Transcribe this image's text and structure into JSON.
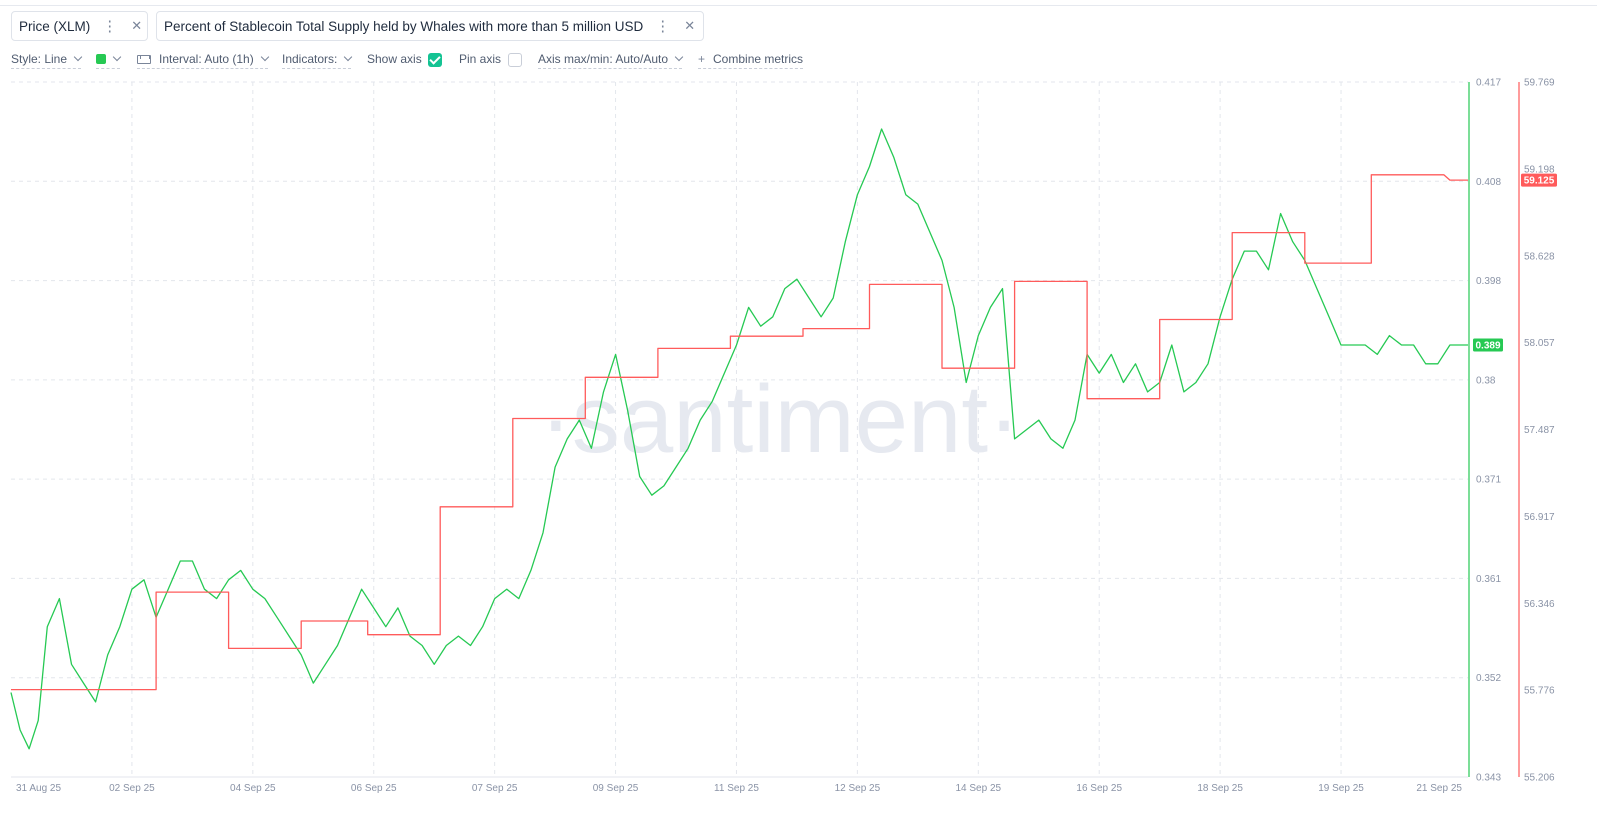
{
  "tabs": [
    {
      "label": "Price (XLM)",
      "color": "#26c953"
    },
    {
      "label": "Percent of Stablecoin Total Supply held by Whales with more than 5 million USD",
      "color": "#ff5b5b"
    }
  ],
  "toolbar": {
    "style": "Style: Line",
    "interval": "Interval: Auto (1h)",
    "indicators": "Indicators:",
    "show_axis": "Show axis",
    "show_axis_checked": true,
    "pin_axis": "Pin axis",
    "pin_axis_checked": false,
    "axis_minmax": "Axis max/min: Auto/Auto",
    "combine": "Combine metrics",
    "plus": "+"
  },
  "watermark": "·santiment·",
  "chart_data": {
    "type": "line",
    "x_dates": [
      "31 Aug 25",
      "02 Sep 25",
      "04 Sep 25",
      "06 Sep 25",
      "07 Sep 25",
      "09 Sep 25",
      "11 Sep 25",
      "12 Sep 25",
      "14 Sep 25",
      "16 Sep 25",
      "18 Sep 25",
      "19 Sep 25",
      "21 Sep 25"
    ],
    "x_tick_positions_day": [
      0,
      2,
      4,
      6,
      8,
      10,
      12,
      14,
      16,
      18,
      20,
      22,
      24
    ],
    "left_axis": {
      "ticks": [
        "0.417",
        "0.408",
        "0.398",
        "0.38",
        "0.371",
        "0.361",
        "0.352",
        "0.343"
      ],
      "ylim": [
        0.343,
        0.417
      ],
      "current": "0.389",
      "color": "#26c953"
    },
    "right_axis": {
      "ticks": [
        "59.769",
        "59.198",
        "58.628",
        "58.057",
        "57.487",
        "56.917",
        "56.346",
        "55.776",
        "55.206"
      ],
      "ylim": [
        55.206,
        59.769
      ],
      "current": "59.125",
      "color": "#ff5b5b"
    },
    "series": [
      {
        "name": "Price (XLM)",
        "axis": "left",
        "color": "#26c953",
        "points": [
          [
            0,
            0.352
          ],
          [
            0.15,
            0.348
          ],
          [
            0.3,
            0.346
          ],
          [
            0.45,
            0.349
          ],
          [
            0.6,
            0.359
          ],
          [
            0.8,
            0.362
          ],
          [
            1,
            0.355
          ],
          [
            1.2,
            0.353
          ],
          [
            1.4,
            0.351
          ],
          [
            1.6,
            0.356
          ],
          [
            1.8,
            0.359
          ],
          [
            2,
            0.363
          ],
          [
            2.2,
            0.364
          ],
          [
            2.4,
            0.36
          ],
          [
            2.6,
            0.363
          ],
          [
            2.8,
            0.366
          ],
          [
            3,
            0.366
          ],
          [
            3.2,
            0.363
          ],
          [
            3.4,
            0.362
          ],
          [
            3.6,
            0.364
          ],
          [
            3.8,
            0.365
          ],
          [
            4,
            0.363
          ],
          [
            4.2,
            0.362
          ],
          [
            4.4,
            0.36
          ],
          [
            4.6,
            0.358
          ],
          [
            4.8,
            0.356
          ],
          [
            5,
            0.353
          ],
          [
            5.2,
            0.355
          ],
          [
            5.4,
            0.357
          ],
          [
            5.6,
            0.36
          ],
          [
            5.8,
            0.363
          ],
          [
            6,
            0.361
          ],
          [
            6.2,
            0.359
          ],
          [
            6.4,
            0.361
          ],
          [
            6.6,
            0.358
          ],
          [
            6.8,
            0.357
          ],
          [
            7,
            0.355
          ],
          [
            7.2,
            0.357
          ],
          [
            7.4,
            0.358
          ],
          [
            7.6,
            0.357
          ],
          [
            7.8,
            0.359
          ],
          [
            8,
            0.362
          ],
          [
            8.2,
            0.363
          ],
          [
            8.4,
            0.362
          ],
          [
            8.6,
            0.365
          ],
          [
            8.8,
            0.369
          ],
          [
            9,
            0.376
          ],
          [
            9.2,
            0.379
          ],
          [
            9.4,
            0.381
          ],
          [
            9.6,
            0.378
          ],
          [
            9.8,
            0.384
          ],
          [
            10,
            0.388
          ],
          [
            10.2,
            0.382
          ],
          [
            10.4,
            0.375
          ],
          [
            10.6,
            0.373
          ],
          [
            10.8,
            0.374
          ],
          [
            11,
            0.376
          ],
          [
            11.2,
            0.378
          ],
          [
            11.4,
            0.381
          ],
          [
            11.6,
            0.383
          ],
          [
            11.8,
            0.386
          ],
          [
            12,
            0.389
          ],
          [
            12.2,
            0.393
          ],
          [
            12.4,
            0.391
          ],
          [
            12.6,
            0.392
          ],
          [
            12.8,
            0.395
          ],
          [
            13,
            0.396
          ],
          [
            13.2,
            0.394
          ],
          [
            13.4,
            0.392
          ],
          [
            13.6,
            0.394
          ],
          [
            13.8,
            0.4
          ],
          [
            14,
            0.405
          ],
          [
            14.2,
            0.408
          ],
          [
            14.4,
            0.412
          ],
          [
            14.6,
            0.409
          ],
          [
            14.8,
            0.405
          ],
          [
            15,
            0.404
          ],
          [
            15.2,
            0.401
          ],
          [
            15.4,
            0.398
          ],
          [
            15.6,
            0.393
          ],
          [
            15.8,
            0.385
          ],
          [
            16,
            0.39
          ],
          [
            16.2,
            0.393
          ],
          [
            16.4,
            0.395
          ],
          [
            16.6,
            0.379
          ],
          [
            16.8,
            0.38
          ],
          [
            17,
            0.381
          ],
          [
            17.2,
            0.379
          ],
          [
            17.4,
            0.378
          ],
          [
            17.6,
            0.381
          ],
          [
            17.8,
            0.388
          ],
          [
            18,
            0.386
          ],
          [
            18.2,
            0.388
          ],
          [
            18.4,
            0.385
          ],
          [
            18.6,
            0.387
          ],
          [
            18.8,
            0.384
          ],
          [
            19,
            0.385
          ],
          [
            19.2,
            0.389
          ],
          [
            19.4,
            0.384
          ],
          [
            19.6,
            0.385
          ],
          [
            19.8,
            0.387
          ],
          [
            20,
            0.392
          ],
          [
            20.2,
            0.396
          ],
          [
            20.4,
            0.399
          ],
          [
            20.6,
            0.399
          ],
          [
            20.8,
            0.397
          ],
          [
            21,
            0.403
          ],
          [
            21.2,
            0.4
          ],
          [
            21.4,
            0.398
          ],
          [
            21.6,
            0.395
          ],
          [
            21.8,
            0.392
          ],
          [
            22,
            0.389
          ],
          [
            22.2,
            0.389
          ],
          [
            22.4,
            0.389
          ],
          [
            22.6,
            0.388
          ],
          [
            22.8,
            0.39
          ],
          [
            23,
            0.389
          ],
          [
            23.2,
            0.389
          ],
          [
            23.4,
            0.387
          ],
          [
            23.6,
            0.387
          ],
          [
            23.8,
            0.389
          ],
          [
            24,
            0.389
          ],
          [
            24.1,
            0.389
          ]
        ]
      },
      {
        "name": "Percent of Stablecoin Total Supply held by Whales with more than 5 million USD",
        "axis": "right",
        "color": "#ff5b5b",
        "points": [
          [
            0,
            55.78
          ],
          [
            1.2,
            55.78
          ],
          [
            2.4,
            55.78
          ],
          [
            2.4,
            56.42
          ],
          [
            3.6,
            56.42
          ],
          [
            3.6,
            56.05
          ],
          [
            4.8,
            56.05
          ],
          [
            4.8,
            56.23
          ],
          [
            5.9,
            56.23
          ],
          [
            5.9,
            56.14
          ],
          [
            7.1,
            56.14
          ],
          [
            7.1,
            56.98
          ],
          [
            8.3,
            56.98
          ],
          [
            8.3,
            57.56
          ],
          [
            9.5,
            57.56
          ],
          [
            9.5,
            57.83
          ],
          [
            10.7,
            57.83
          ],
          [
            10.7,
            58.02
          ],
          [
            11.9,
            58.02
          ],
          [
            11.9,
            58.1
          ],
          [
            13.1,
            58.1
          ],
          [
            13.1,
            58.15
          ],
          [
            14.2,
            58.15
          ],
          [
            14.2,
            58.44
          ],
          [
            15.4,
            58.44
          ],
          [
            15.4,
            57.89
          ],
          [
            16.6,
            57.89
          ],
          [
            16.6,
            58.46
          ],
          [
            17.8,
            58.46
          ],
          [
            17.8,
            57.69
          ],
          [
            19,
            57.69
          ],
          [
            19,
            58.21
          ],
          [
            20.2,
            58.21
          ],
          [
            20.2,
            58.78
          ],
          [
            21.4,
            58.78
          ],
          [
            21.4,
            58.58
          ],
          [
            22.5,
            58.58
          ],
          [
            22.5,
            59.16
          ],
          [
            23.7,
            59.16
          ],
          [
            23.8,
            59.125
          ],
          [
            24.1,
            59.125
          ]
        ]
      }
    ],
    "grid": true,
    "legend": "top-left tabs"
  }
}
